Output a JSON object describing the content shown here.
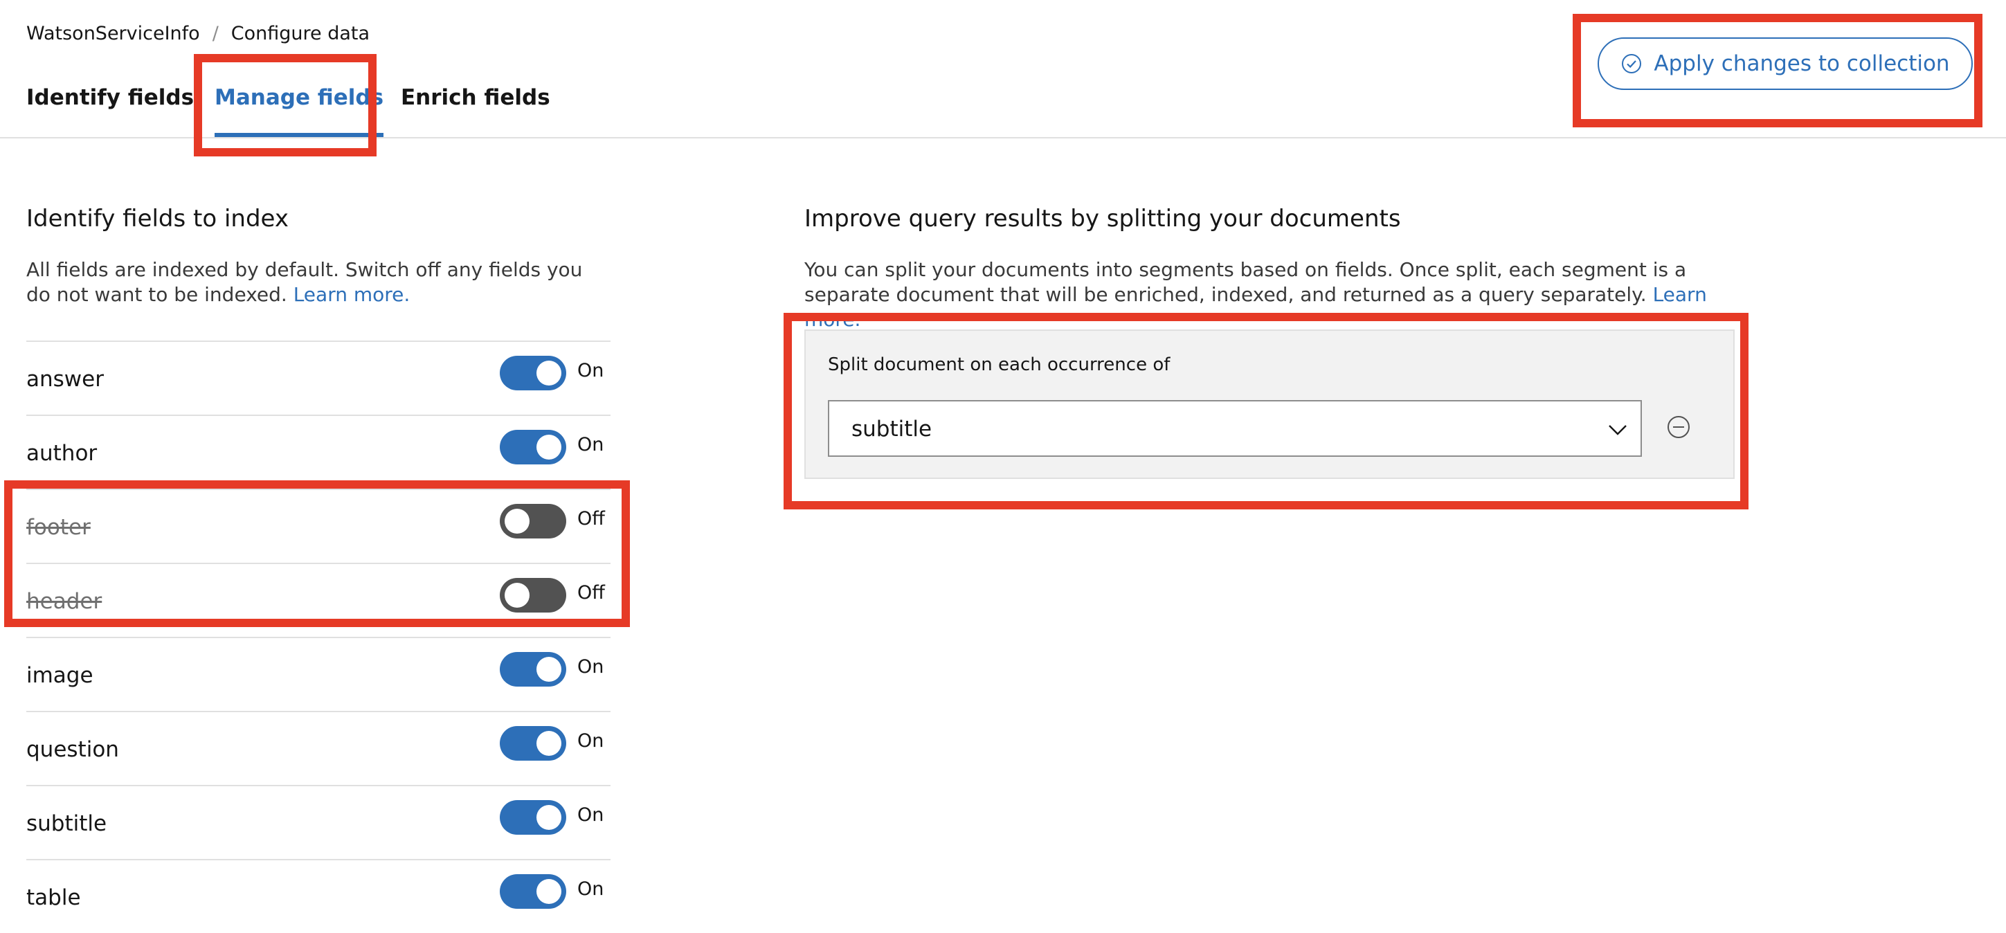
{
  "breadcrumb": {
    "parent": "WatsonServiceInfo",
    "separator": "/",
    "current": "Configure data"
  },
  "tabs": [
    {
      "label": "Identify fields",
      "active": false
    },
    {
      "label": "Manage fields",
      "active": true
    },
    {
      "label": "Enrich fields",
      "active": false
    }
  ],
  "apply_button": {
    "label": "Apply changes to collection",
    "icon": "checkmark-outline-icon"
  },
  "index_section": {
    "title": "Identify fields to index",
    "description": "All fields are indexed by default. Switch off any fields you do not want to be indexed.",
    "link": "Learn more.",
    "fields": [
      {
        "name": "answer",
        "state": "On",
        "on": true
      },
      {
        "name": "author",
        "state": "On",
        "on": true
      },
      {
        "name": "footer",
        "state": "Off",
        "on": false
      },
      {
        "name": "header",
        "state": "Off",
        "on": false
      },
      {
        "name": "image",
        "state": "On",
        "on": true
      },
      {
        "name": "question",
        "state": "On",
        "on": true
      },
      {
        "name": "subtitle",
        "state": "On",
        "on": true
      },
      {
        "name": "table",
        "state": "On",
        "on": true
      }
    ]
  },
  "split_section": {
    "title": "Improve query results by splitting your documents",
    "description": "You can split your documents into segments based on fields. Once split, each segment is a separate document that will be enriched, indexed, and returned as a query separately.",
    "link": "Learn more.",
    "split_label": "Split document on each occurrence of",
    "selected_field": "subtitle",
    "remove_icon": "subtract-circle-icon"
  },
  "colors": {
    "accent": "#2d6fb8",
    "highlight": "#e63a26",
    "toggle_off": "#525252"
  }
}
